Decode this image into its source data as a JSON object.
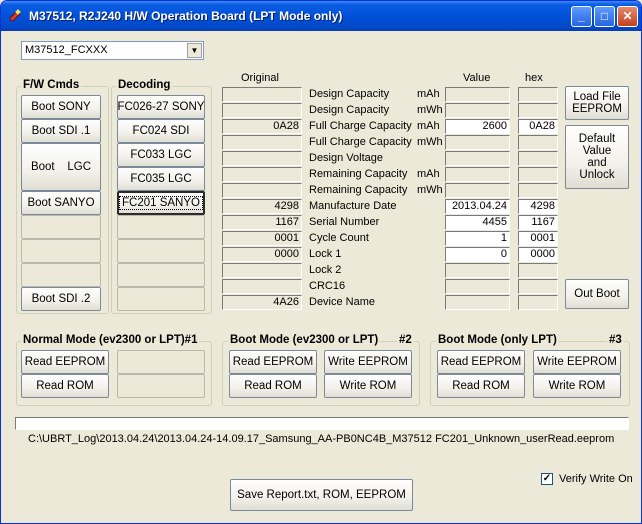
{
  "window": {
    "title": "M37512, R2J240  H/W Operation Board  (LPT Mode only)",
    "buttons": {
      "minimize": "_",
      "maximize": "□",
      "close": "✕"
    }
  },
  "device_select": {
    "value": "M37512_FCXXX",
    "arrow": "▼"
  },
  "fw_cmds": {
    "label": "F/W Cmds",
    "buttons": [
      "Boot SONY",
      "Boot SDI .1",
      "Boot    LGC",
      "Boot SANYO",
      "",
      "",
      "",
      "Boot SDI .2"
    ]
  },
  "decoding": {
    "label": "Decoding",
    "buttons": [
      "FC026-27 SONY",
      "FC024 SDI",
      "FC033 LGC",
      "FC035 LGC",
      "FC201 SANYO"
    ],
    "selected_index": 4
  },
  "table": {
    "original_header": "Original",
    "value_header": "Value",
    "hex_header": "hex",
    "rows": [
      {
        "label": "Design Capacity",
        "unit": "mAh",
        "original": "",
        "value": "",
        "hex": "",
        "value_white": false
      },
      {
        "label": "Design Capacity",
        "unit": "mWh",
        "original": "",
        "value": "",
        "hex": "",
        "value_white": false
      },
      {
        "label": "Full Charge Capacity",
        "unit": "mAh",
        "original": "0A28",
        "value": "2600",
        "hex": "0A28",
        "value_white": true
      },
      {
        "label": "Full Charge Capacity",
        "unit": "mWh",
        "original": "",
        "value": "",
        "hex": "",
        "value_white": false
      },
      {
        "label": "Design Voltage",
        "unit": "",
        "original": "",
        "value": "",
        "hex": "",
        "value_white": false
      },
      {
        "label": "Remaining Capacity",
        "unit": "mAh",
        "original": "",
        "value": "",
        "hex": "",
        "value_white": false
      },
      {
        "label": "Remaining Capacity",
        "unit": "mWh",
        "original": "",
        "value": "",
        "hex": "",
        "value_white": false
      },
      {
        "label": "Manufacture Date",
        "unit": "",
        "original": "4298",
        "value": "2013.04.24",
        "hex": "4298",
        "value_white": true
      },
      {
        "label": "Serial Number",
        "unit": "",
        "original": "1167",
        "value": "4455",
        "hex": "1167",
        "value_white": true
      },
      {
        "label": "Cycle Count",
        "unit": "",
        "original": "0001",
        "value": "1",
        "hex": "0001",
        "value_white": true
      },
      {
        "label": "Lock 1",
        "unit": "",
        "original": "0000",
        "value": "0",
        "hex": "0000",
        "value_white": true
      },
      {
        "label": "Lock 2",
        "unit": "",
        "original": "",
        "value": "",
        "hex": "",
        "value_white": false
      },
      {
        "label": "CRC16",
        "unit": "",
        "original": "",
        "value": "",
        "hex": "",
        "value_white": false
      },
      {
        "label": "Device Name",
        "unit": "",
        "original": "4A26",
        "value": "",
        "hex": "",
        "value_white": false
      }
    ]
  },
  "right_buttons": {
    "load": "Load File\nEEPROM",
    "default": "Default\nValue\nand\nUnlock",
    "out_boot": "Out Boot"
  },
  "normal_mode": {
    "label": "Normal Mode (ev2300 or LPT)#1",
    "read_eeprom": "Read EEPROM",
    "read_rom": "Read ROM"
  },
  "boot_mode_2": {
    "label": "Boot Mode (ev2300 or LPT)",
    "num": "#2",
    "read_eeprom": "Read EEPROM",
    "write_eeprom": "Write EEPROM",
    "read_rom": "Read ROM",
    "write_rom": "Write ROM"
  },
  "boot_mode_3": {
    "label": "Boot Mode (only LPT)",
    "num": "#3",
    "read_eeprom": "Read EEPROM",
    "write_eeprom": "Write EEPROM",
    "read_rom": "Read ROM",
    "write_rom": "Write ROM"
  },
  "file_path": "C:\\UBRT_Log\\2013.04.24\\2013.04.24-14.09.17_Samsung_AA-PB0NC4B_M37512  FC201_Unknown_userRead.eeprom",
  "verify_write": {
    "label": "Verify Write On",
    "checked": true,
    "mark": "✓"
  },
  "save_report": "Save Report.txt, ROM, EEPROM"
}
